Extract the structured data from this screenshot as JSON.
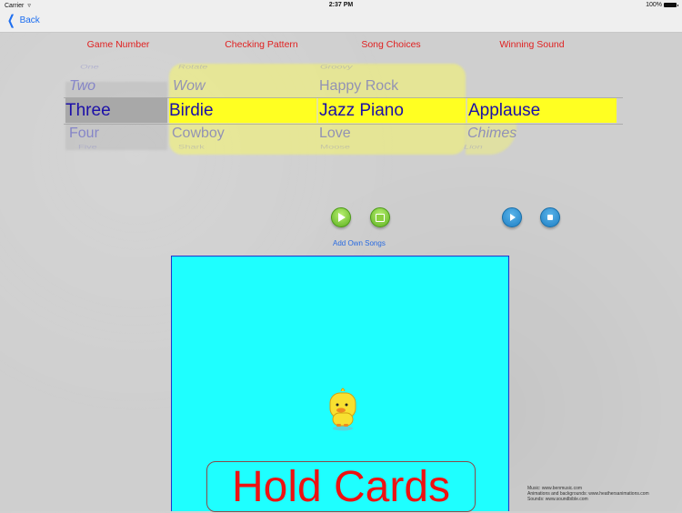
{
  "status_bar": {
    "carrier": "Carrier",
    "time": "2:37 PM",
    "battery": "100%"
  },
  "nav": {
    "back_label": "Back"
  },
  "columns": {
    "game_number": {
      "label": "Game Number",
      "items": [
        "One",
        "Two",
        "Three",
        "Four",
        "Five"
      ],
      "selected": "Three"
    },
    "checking_pattern": {
      "label": "Checking Pattern",
      "items": [
        "Rotate",
        "Wow",
        "Birdie",
        "Cowboy",
        "Shark"
      ],
      "selected": "Birdie"
    },
    "song_choices": {
      "label": "Song Choices",
      "items": [
        "Groovy",
        "Happy Rock",
        "Jazz Piano",
        "Love",
        "Moose"
      ],
      "selected": "Jazz Piano"
    },
    "winning_sound": {
      "label": "Winning Sound",
      "items": [
        "",
        "",
        "Applause",
        "Chimes",
        "Lion"
      ],
      "selected": "Applause"
    }
  },
  "song_controls": {
    "add_songs_label": "Add Own Songs"
  },
  "stage": {
    "hold_label": "Hold Cards",
    "background": "#1effff"
  },
  "credits": [
    "Music: www.benmusic.com",
    "Animations and backgrounds: www.heathersanimations.com",
    "Sounds: www.soundbible.com"
  ],
  "colors": {
    "accent_red": "#e02020",
    "link_blue": "#2a6be0",
    "picker_highlight": "#ffff33",
    "selected_text": "#1c10a8"
  }
}
